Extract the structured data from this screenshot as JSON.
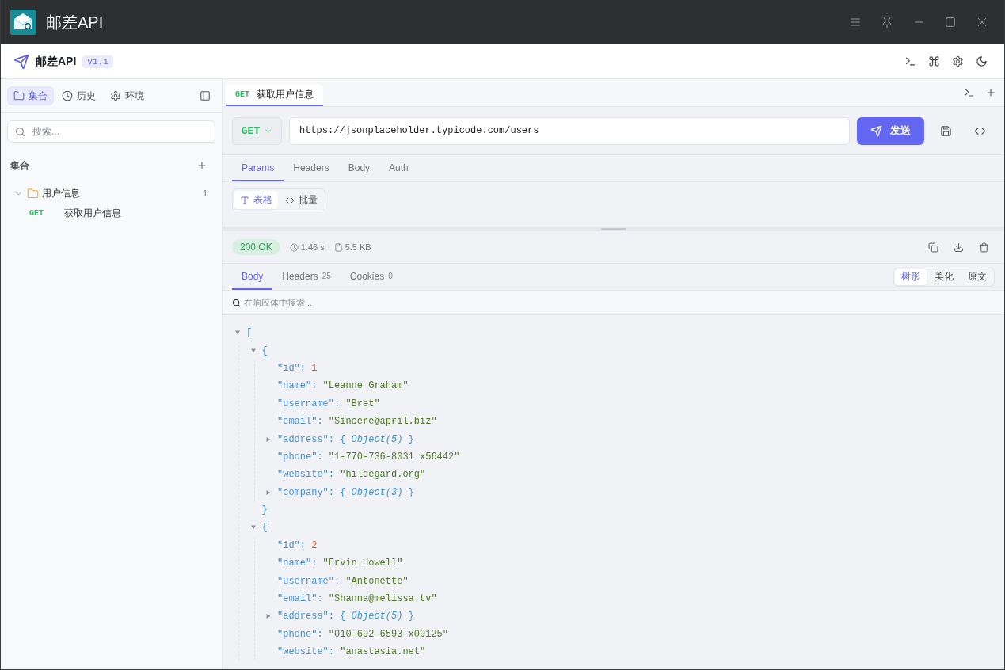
{
  "titlebar": {
    "title": "邮差API"
  },
  "header": {
    "app_name": "邮差API",
    "version": "v1.1"
  },
  "sidebar": {
    "tabs": [
      {
        "label": "集合",
        "selected": true
      },
      {
        "label": "历史",
        "selected": false
      },
      {
        "label": "环境",
        "selected": false
      }
    ],
    "search": {
      "placeholder": "搜索..."
    },
    "section_title": "集合",
    "tree": [
      {
        "name": "用户信息",
        "count": "1",
        "expanded": true,
        "children": [
          {
            "method": "GET",
            "name": "获取用户信息"
          }
        ]
      }
    ]
  },
  "request_tabs": [
    {
      "method": "GET",
      "name": "获取用户信息",
      "selected": true
    }
  ],
  "request": {
    "method": "GET",
    "url": "https://jsonplaceholder.typicode.com/users",
    "send_label": "发送",
    "tabs": [
      {
        "label": "Params",
        "selected": true
      },
      {
        "label": "Headers",
        "selected": false
      },
      {
        "label": "Body",
        "selected": false
      },
      {
        "label": "Auth",
        "selected": false
      }
    ],
    "param_modes": [
      {
        "label": "表格",
        "selected": true
      },
      {
        "label": "批量",
        "selected": false
      }
    ]
  },
  "response": {
    "status": "200 OK",
    "time": "1.46 s",
    "size": "5.5 KB",
    "tabs": [
      {
        "label": "Body",
        "selected": true
      },
      {
        "label": "Headers",
        "count": "25",
        "selected": false
      },
      {
        "label": "Cookies",
        "count": "0",
        "selected": false
      }
    ],
    "views": [
      {
        "label": "树形",
        "selected": true
      },
      {
        "label": "美化",
        "selected": false
      },
      {
        "label": "原文",
        "selected": false
      }
    ],
    "search": {
      "placeholder": "在响应体中搜索..."
    },
    "body_tree": {
      "kind": "array",
      "open": "[",
      "expanded": true,
      "children": [
        {
          "kind": "object",
          "open": "{",
          "expanded": true,
          "children": [
            {
              "kind": "number",
              "key": "\"id\":",
              "value": "1"
            },
            {
              "kind": "string",
              "key": "\"name\":",
              "value": "\"Leanne Graham\""
            },
            {
              "kind": "string",
              "key": "\"username\":",
              "value": "\"Bret\""
            },
            {
              "kind": "string",
              "key": "\"email\":",
              "value": "\"Sincere@april.biz\""
            },
            {
              "kind": "collapsed",
              "key": "\"address\":",
              "summary": "{ *Object(5)* }",
              "expanded": false
            },
            {
              "kind": "string",
              "key": "\"phone\":",
              "value": "\"1-770-736-8031 x56442\""
            },
            {
              "kind": "string",
              "key": "\"website\":",
              "value": "\"hildegard.org\""
            },
            {
              "kind": "collapsed",
              "key": "\"company\":",
              "summary": "{ *Object(3)* }",
              "expanded": false
            }
          ],
          "close": "}"
        },
        {
          "kind": "object",
          "open": "{",
          "expanded": true,
          "children": [
            {
              "kind": "number",
              "key": "\"id\":",
              "value": "2"
            },
            {
              "kind": "string",
              "key": "\"name\":",
              "value": "\"Ervin Howell\""
            },
            {
              "kind": "string",
              "key": "\"username\":",
              "value": "\"Antonette\""
            },
            {
              "kind": "string",
              "key": "\"email\":",
              "value": "\"Shanna@melissa.tv\""
            },
            {
              "kind": "collapsed",
              "key": "\"address\":",
              "summary": "{ *Object(5)* }",
              "expanded": false
            },
            {
              "kind": "string",
              "key": "\"phone\":",
              "value": "\"010-692-6593 x09125\""
            },
            {
              "kind": "string",
              "key": "\"website\":",
              "value": "\"anastasia.net\""
            }
          ]
        }
      ]
    }
  }
}
